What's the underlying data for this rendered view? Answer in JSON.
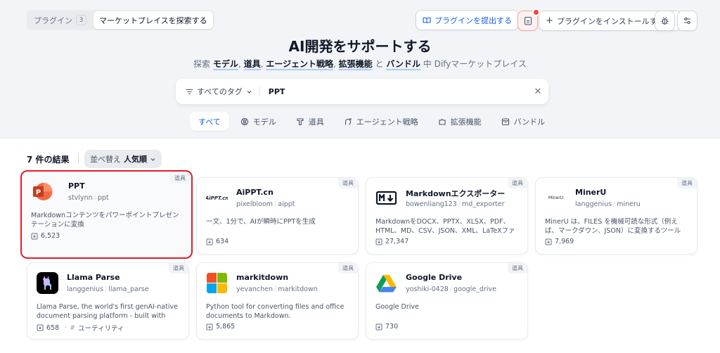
{
  "header": {
    "tabs": [
      {
        "label": "プラグイン",
        "count": "3"
      },
      {
        "label": "マーケットプレイスを探索する"
      }
    ],
    "submit_plugin_label": "プラグインを提出する",
    "install_plugin_label": "プラグインをインストールする"
  },
  "hero": {
    "title": "AI開発をサポートする",
    "subtitle": {
      "prefix": "探索",
      "model": "モデル",
      "comma1": ",",
      "tool": "道具",
      "comma2": ",",
      "agent": "エージェント戦略",
      "comma3": ",",
      "extension": "拡張機能",
      "and": "と",
      "bundle": "バンドル",
      "suffix": "中 Difyマーケットプレイス"
    }
  },
  "search": {
    "tag_filter_label": "すべてのタグ",
    "query": "PPT"
  },
  "categories": [
    {
      "label": "すべて",
      "icon": "none",
      "active": true
    },
    {
      "label": "モデル",
      "icon": "model-icon"
    },
    {
      "label": "道具",
      "icon": "tool-icon"
    },
    {
      "label": "エージェント戦略",
      "icon": "agent-icon"
    },
    {
      "label": "拡張機能",
      "icon": "extension-icon"
    },
    {
      "label": "バンドル",
      "icon": "bundle-icon"
    }
  ],
  "results": {
    "count_label": "7 件の結果",
    "sort_prefix": "並べ替え",
    "sort_value": "人気順"
  },
  "plugins": [
    {
      "name": "PPT",
      "org": "stvlynn",
      "slug": "ppt",
      "type": "道具",
      "desc": "Markdownコンテンツをパワーポイントプレゼンテーションに変換",
      "installs": "6,523",
      "selected": true
    },
    {
      "name": "AiPPT.cn",
      "org": "pixelbloom",
      "slug": "aippt",
      "type": "道具",
      "desc": "一文、1分で、AIが瞬時にPPTを生成",
      "installs": "634"
    },
    {
      "name": "Markdownエクスポーター",
      "org": "bowenliang123",
      "slug": "md_exporter",
      "type": "道具",
      "desc": "MarkdownをDOCX、PPTX、XLSX、PDF、HTML、MD、CSV、JSON、XML、LaTeXファイルとしてエク...",
      "installs": "27,347"
    },
    {
      "name": "MinerU",
      "org": "langgenius",
      "slug": "mineru",
      "type": "道具",
      "desc": "MinerU は、FILES を機械可読な形式（例えば、マークダウン、JSON）に変換するツールで、どんな形...",
      "installs": "7,969"
    },
    {
      "name": "Llama Parse",
      "org": "langgenius",
      "slug": "llama_parse",
      "type": "道具",
      "desc": "Llama Parse, the world's first genAI-native document parsing platform - built with LLM...",
      "installs": "658",
      "tag": "ユーティリティ"
    },
    {
      "name": "markitdown",
      "org": "yevanchen",
      "slug": "markitdown",
      "type": "道具",
      "desc": "Python tool for converting files and office documents to Markdown.",
      "installs": "5,865"
    },
    {
      "name": "Google Drive",
      "org": "yoshiki-0428",
      "slug": "google_drive",
      "type": "道具",
      "desc": "Google Drive",
      "installs": "730"
    }
  ],
  "logos": {
    "aippt_text": "AiPPT.cn",
    "mineru_text": "MinerU",
    "ppt_letter": "P"
  },
  "colors": {
    "accent": "#155eef",
    "selected_border": "#e11d2a"
  }
}
